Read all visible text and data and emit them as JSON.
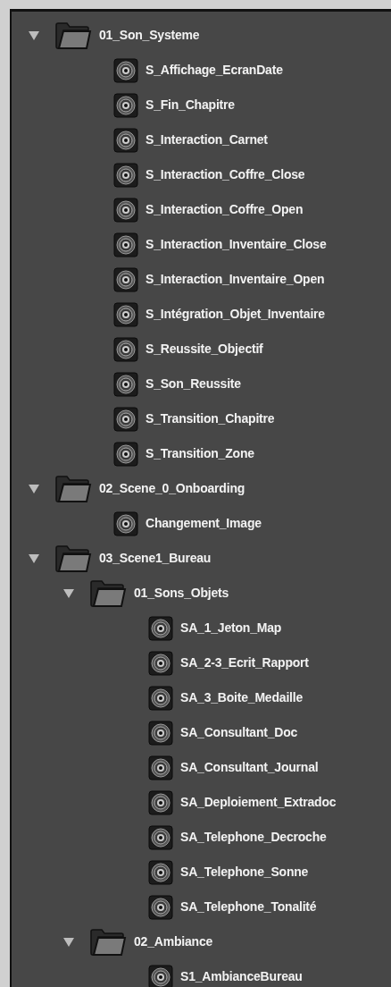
{
  "tree": [
    {
      "kind": "folder",
      "label": "01_Son_Systeme",
      "expanded": true,
      "children": [
        {
          "kind": "event",
          "label": "S_Affichage_EcranDate"
        },
        {
          "kind": "event",
          "label": "S_Fin_Chapitre"
        },
        {
          "kind": "event",
          "label": "S_Interaction_Carnet"
        },
        {
          "kind": "event",
          "label": "S_Interaction_Coffre_Close"
        },
        {
          "kind": "event",
          "label": "S_Interaction_Coffre_Open"
        },
        {
          "kind": "event",
          "label": "S_Interaction_Inventaire_Close"
        },
        {
          "kind": "event",
          "label": "S_Interaction_Inventaire_Open"
        },
        {
          "kind": "event",
          "label": "S_Intégration_Objet_Inventaire"
        },
        {
          "kind": "event",
          "label": "S_Reussite_Objectif"
        },
        {
          "kind": "event",
          "label": "S_Son_Reussite"
        },
        {
          "kind": "event",
          "label": "S_Transition_Chapitre"
        },
        {
          "kind": "event",
          "label": "S_Transition_Zone"
        }
      ]
    },
    {
      "kind": "folder",
      "label": "02_Scene_0_Onboarding",
      "expanded": true,
      "children": [
        {
          "kind": "event",
          "label": "Changement_Image"
        }
      ]
    },
    {
      "kind": "folder",
      "label": "03_Scene1_Bureau",
      "expanded": true,
      "children": [
        {
          "kind": "folder",
          "label": "01_Sons_Objets",
          "expanded": true,
          "children": [
            {
              "kind": "event",
              "label": "SA_1_Jeton_Map"
            },
            {
              "kind": "event",
              "label": "SA_2-3_Ecrit_Rapport"
            },
            {
              "kind": "event",
              "label": "SA_3_Boite_Medaille"
            },
            {
              "kind": "event",
              "label": "SA_Consultant_Doc"
            },
            {
              "kind": "event",
              "label": "SA_Consultant_Journal"
            },
            {
              "kind": "event",
              "label": "SA_Deploiement_Extradoc"
            },
            {
              "kind": "event",
              "label": "SA_Telephone_Decroche"
            },
            {
              "kind": "event",
              "label": "SA_Telephone_Sonne"
            },
            {
              "kind": "event",
              "label": "SA_Telephone_Tonalité"
            }
          ]
        },
        {
          "kind": "folder",
          "label": "02_Ambiance",
          "expanded": true,
          "children": [
            {
              "kind": "event",
              "label": "S1_AmbianceBureau"
            }
          ]
        }
      ]
    }
  ]
}
